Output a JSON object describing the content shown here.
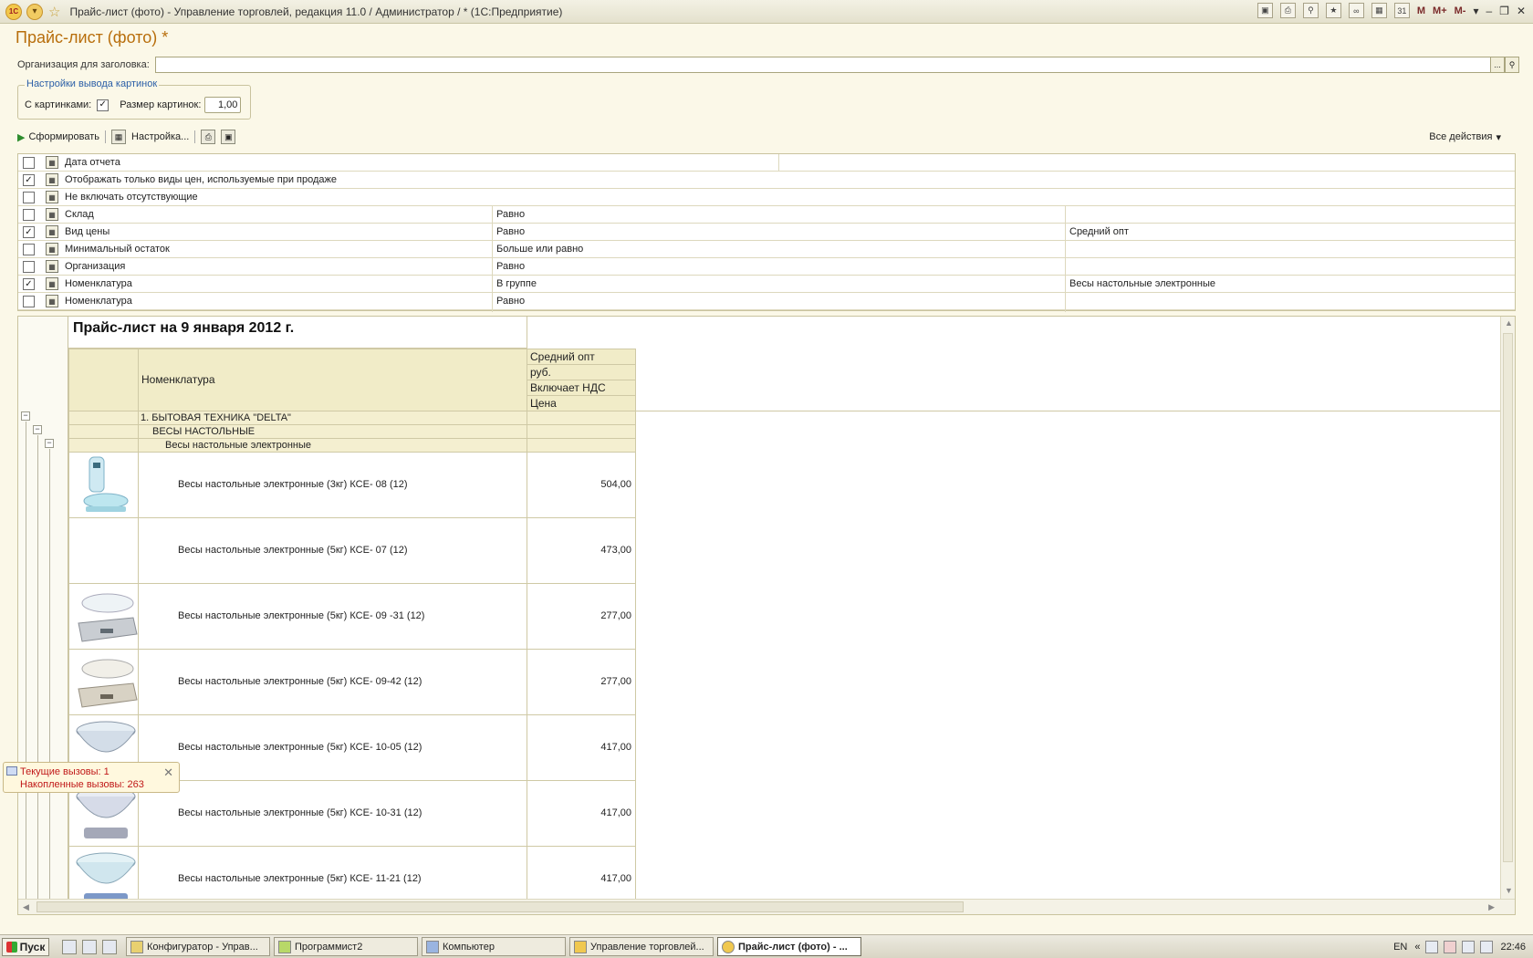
{
  "window": {
    "title": "Прайс-лист (фото) - Управление торговлей, редакция 11.0 / Администратор / * (1С:Предприятие)",
    "logo_text": "1С",
    "toolbar_m_labels": [
      "M",
      "M+",
      "M-"
    ]
  },
  "form": {
    "title": "Прайс-лист (фото) *",
    "org_label": "Организация для заголовка:",
    "org_value": "",
    "picture_group": {
      "legend": "Настройки вывода картинок",
      "with_pictures_label": "С картинками:",
      "with_pictures": true,
      "size_label": "Размер картинок:",
      "size_value": "1,00"
    }
  },
  "commandbar": {
    "generate": "Сформировать",
    "settings": "Настройка...",
    "all_actions": "Все действия"
  },
  "settings_rows": [
    {
      "checked": false,
      "field": "Дата отчета",
      "condition": "",
      "value": ""
    },
    {
      "checked": true,
      "field": "Отображать только виды цен, используемые при продаже",
      "condition": "",
      "value": ""
    },
    {
      "checked": false,
      "field": "Не включать отсутствующие",
      "condition": "",
      "value": ""
    },
    {
      "checked": false,
      "field": "Склад",
      "condition": "Равно",
      "value": ""
    },
    {
      "checked": true,
      "field": "Вид цены",
      "condition": "Равно",
      "value": "Средний опт"
    },
    {
      "checked": false,
      "field": "Минимальный остаток",
      "condition": "Больше или равно",
      "value": ""
    },
    {
      "checked": false,
      "field": "Организация",
      "condition": "Равно",
      "value": ""
    },
    {
      "checked": true,
      "field": "Номенклатура",
      "condition": "В группе",
      "value": "Весы настольные электронные"
    },
    {
      "checked": false,
      "field": "Номенклатура",
      "condition": "Равно",
      "value": ""
    }
  ],
  "report": {
    "title": "Прайс-лист на 9 января 2012 г.",
    "header": {
      "nomenclature": "Номенклатура",
      "price_type": "Средний опт",
      "currency": "руб.",
      "vat": "Включает НДС",
      "price": "Цена"
    },
    "groups": [
      "1. БЫТОВАЯ ТЕХНИКА \"DELTA\"",
      "ВЕСЫ НАСТОЛЬНЫЕ",
      "Весы настольные электронные"
    ],
    "items": [
      {
        "name": "Весы настольные электронные (3кг) КСЕ- 08 (12)",
        "price": "504,00",
        "pic": "tall"
      },
      {
        "name": "Весы настольные электронные (5кг) КСЕ- 07 (12)",
        "price": "473,00",
        "pic": "none"
      },
      {
        "name": "Весы настольные электронные (5кг) КСЕ- 09 -31 (12)",
        "price": "277,00",
        "pic": "flat"
      },
      {
        "name": "Весы настольные электронные (5кг) КСЕ- 09-42 (12)",
        "price": "277,00",
        "pic": "flat"
      },
      {
        "name": "Весы настольные электронные (5кг) КСЕ- 10-05 (12)",
        "price": "417,00",
        "pic": "bowl"
      },
      {
        "name": "Весы настольные электронные (5кг) КСЕ- 10-31 (12)",
        "price": "417,00",
        "pic": "bowl"
      },
      {
        "name": "Весы настольные электронные (5кг) КСЕ- 11-21 (12)",
        "price": "417,00",
        "pic": "bowl"
      }
    ]
  },
  "popup": {
    "current_calls": "Текущие вызовы: 1",
    "accumulated_calls": "Накопленные вызовы: 263"
  },
  "taskbar": {
    "start": "Пуск",
    "tasks": [
      {
        "label": "Конфигуратор - Управ...",
        "active": false
      },
      {
        "label": "Программист2",
        "active": false
      },
      {
        "label": "Компьютер",
        "active": false
      },
      {
        "label": "Управление торговлей...",
        "active": false
      },
      {
        "label": "Прайс-лист (фото) - ...",
        "active": true
      }
    ],
    "lang": "EN",
    "time": "22:46"
  }
}
